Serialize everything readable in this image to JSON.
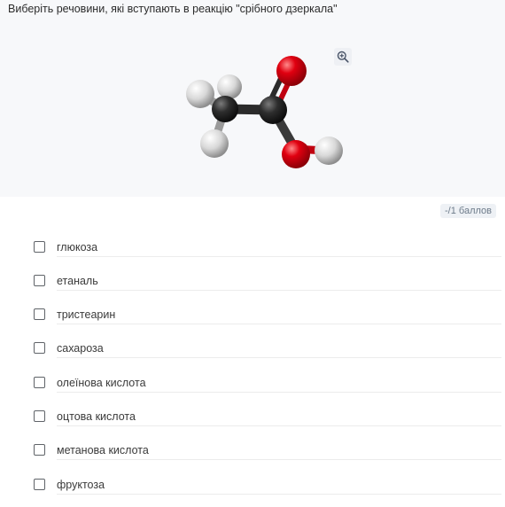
{
  "question": {
    "title": "Виберіть речовини, які вступають в реакцію \"срібного дзеркала\"",
    "image_alt_icon": "molecule-image",
    "zoom_icon": "zoom-in-icon"
  },
  "score": {
    "label": "-/1 баллов"
  },
  "options": [
    {
      "label": "глюкоза",
      "checked": false
    },
    {
      "label": "етаналь",
      "checked": false
    },
    {
      "label": "тристеарин",
      "checked": false
    },
    {
      "label": "сахароза",
      "checked": false
    },
    {
      "label": "олеїнова кислота",
      "checked": false
    },
    {
      "label": "оцтова кислота",
      "checked": false
    },
    {
      "label": "метанова кислота",
      "checked": false
    },
    {
      "label": "фруктоза",
      "checked": false
    }
  ],
  "colors": {
    "header_bg": "#f7f8fa",
    "carbon": "#2a2a2a",
    "oxygen": "#e0000a",
    "hydrogen": "#dcdcdc"
  }
}
